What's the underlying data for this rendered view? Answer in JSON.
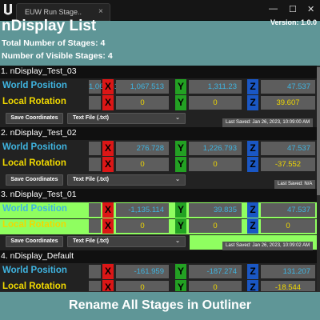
{
  "window": {
    "tab_title": "EUW Run Stage..",
    "close_glyph": "×",
    "min_glyph": "—",
    "max_glyph": "☐",
    "close_win_glyph": "✕"
  },
  "header": {
    "title": "nDisplay List",
    "version": "Version: 1.0.0",
    "total_label": "Total Number of Stages:  4",
    "visible_label": "Number of Visible Stages:  4"
  },
  "labels": {
    "world_position": "World Position",
    "local_rotation": "Local Rotation",
    "x": "X",
    "y": "Y",
    "z": "Z",
    "save_coordinates": "Save Coordinates",
    "file_type": "Text File (.txt)",
    "chevron": "⌄"
  },
  "stages": [
    {
      "name": "1. nDisplay_Test_03",
      "pos": [
        "1,067.513",
        "1,311.23",
        "47.537"
      ],
      "rot": [
        "0",
        "0",
        "39.607"
      ],
      "last_saved": "Last Saved: Jan 26, 2023, 10:09:00 AM",
      "highlight": false
    },
    {
      "name": "2. nDisplay_Test_02",
      "pos": [
        "276.728",
        "1,226.793",
        "47.537"
      ],
      "rot": [
        "0",
        "0",
        "-37.552"
      ],
      "last_saved": "Last Saved: N/A",
      "highlight": false
    },
    {
      "name": "3. nDisplay_Test_01",
      "pos": [
        "-1,135.114",
        "39.835",
        "47.537"
      ],
      "rot": [
        "0",
        "0",
        "0"
      ],
      "last_saved": "Last Saved: Jan 26, 2023, 10:09:02 AM",
      "highlight": true
    },
    {
      "name": "4. nDisplay_Default",
      "pos": [
        "-161.959",
        "-187.274",
        "131.207"
      ],
      "rot": [
        "0",
        "0",
        "-18.544"
      ],
      "last_saved": "",
      "highlight": false
    }
  ],
  "footer": {
    "rename_label": "Rename All Stages in Outliner"
  },
  "colors": {
    "header_bg": "#5f9697",
    "world_position": "#3fb4e0",
    "local_rotation": "#f0d800",
    "x_axis": "#dc1616",
    "y_axis": "#23a123",
    "z_axis": "#1a57c4",
    "highlight": "#8ffe60"
  }
}
